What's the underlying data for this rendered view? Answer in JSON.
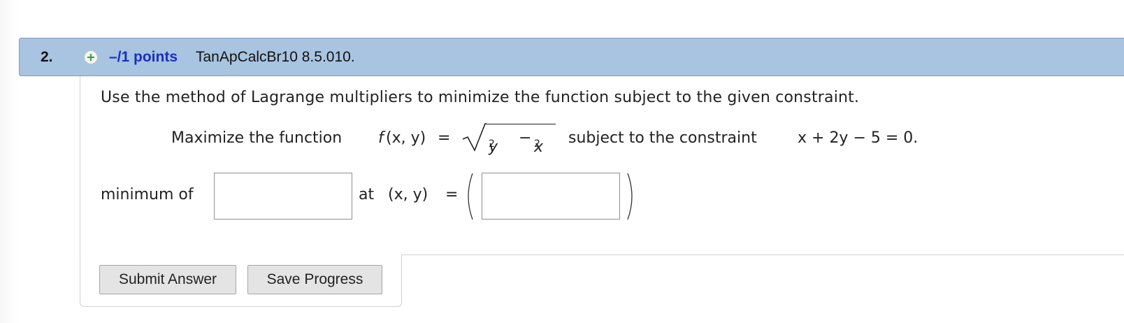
{
  "question": {
    "number": "2.",
    "points": "–/1 points",
    "source": "TanApCalcBr10 8.5.010."
  },
  "icons": {
    "expand": "plus-circle-icon"
  },
  "instructions": "Use the method of Lagrange multipliers to minimize the function subject to the given constraint.",
  "problem": {
    "lead": "Maximize the function",
    "func_name": "f",
    "func_args": "(x, y)",
    "equals": "=",
    "radicand_y": "y",
    "radicand_x": "x",
    "exponent": "2",
    "minus": "−",
    "constraint_lead": "subject to the constraint",
    "constraint": "x + 2y − 5 = 0."
  },
  "answer": {
    "min_label": "minimum of",
    "at_label": "at",
    "point_label": "(x, y)",
    "equals": "=",
    "open_paren": "(",
    "close_paren": ")",
    "min_value": "",
    "point_value": ""
  },
  "buttons": {
    "submit": "Submit Answer",
    "save": "Save Progress"
  },
  "colors": {
    "header_bg": "#a8c4e0",
    "points_text": "#1a2fc2",
    "plus_icon": "#2f9a2f"
  }
}
